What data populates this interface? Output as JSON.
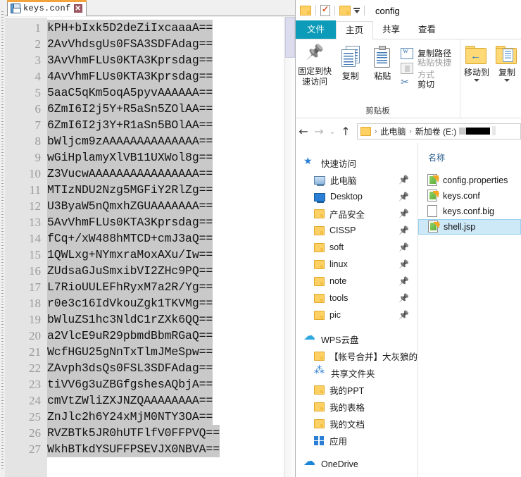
{
  "editor": {
    "tab": {
      "label": "keys.conf",
      "icon": "save-disk-icon",
      "close_label": "✕"
    },
    "lines": [
      {
        "no": "1",
        "text": "kPH+bIxk5D2deZiIxcaaaA=="
      },
      {
        "no": "2",
        "text": "2AvVhdsgUs0FSA3SDFAdag=="
      },
      {
        "no": "3",
        "text": "3AvVhmFLUs0KTA3Kprsdag=="
      },
      {
        "no": "4",
        "text": "4AvVhmFLUs0KTA3Kprsdag=="
      },
      {
        "no": "5",
        "text": "5aaC5qKm5oqA5pyvAAAAAA=="
      },
      {
        "no": "6",
        "text": "6ZmI6I2j5Y+R5aSn5ZOlAA=="
      },
      {
        "no": "7",
        "text": "6ZmI6I2j3Y+R1aSn5BOlAA=="
      },
      {
        "no": "8",
        "text": "bWljcm9zAAAAAAAAAAAAAA=="
      },
      {
        "no": "9",
        "text": "wGiHplamyXlVB11UXWol8g=="
      },
      {
        "no": "10",
        "text": "Z3VucwAAAAAAAAAAAAAAAA=="
      },
      {
        "no": "11",
        "text": "MTIzNDU2Nzg5MGFiY2RlZg=="
      },
      {
        "no": "12",
        "text": "U3ByaW5nQmxhZGUAAAAAAA=="
      },
      {
        "no": "13",
        "text": "5AvVhmFLUs0KTA3Kprsdag=="
      },
      {
        "no": "14",
        "text": "fCq+/xW488hMTCD+cmJ3aQ=="
      },
      {
        "no": "15",
        "text": "1QWLxg+NYmxraMoxAXu/Iw=="
      },
      {
        "no": "16",
        "text": "ZUdsaGJuSmxibVI2ZHc9PQ=="
      },
      {
        "no": "17",
        "text": "L7RioUULEFhRyxM7a2R/Yg=="
      },
      {
        "no": "18",
        "text": "r0e3c16IdVkouZgk1TKVMg=="
      },
      {
        "no": "19",
        "text": "bWluZS1hc3NldC1rZXk6QQ=="
      },
      {
        "no": "20",
        "text": "a2VlcE9uR29pbmdBbmRGaQ=="
      },
      {
        "no": "21",
        "text": "WcfHGU25gNnTxTlmJMeSpw=="
      },
      {
        "no": "22",
        "text": "ZAvph3dsQs0FSL3SDFAdag=="
      },
      {
        "no": "23",
        "text": "tiVV6g3uZBGfgshesAQbjA=="
      },
      {
        "no": "24",
        "text": "cmVtZWliZXJNZQAAAAAAAA=="
      },
      {
        "no": "25",
        "text": "ZnJlc2h6Y24xMjM0NTY3OA=="
      },
      {
        "no": "26",
        "text": "RVZBTk5JR0hUTFlfV0FFPVQ=="
      },
      {
        "no": "27",
        "text": "WkhBTkdYSUFFPSEVJX0NBVA=="
      }
    ]
  },
  "explorer": {
    "titlebar": {
      "title": "config",
      "quick_access_icons": [
        "folder-icon",
        "properties-icon",
        "new-folder-icon",
        "customize-caret-icon"
      ]
    },
    "tabs": [
      {
        "label": "文件",
        "state": "file-menu"
      },
      {
        "label": "主页",
        "state": "active"
      },
      {
        "label": "共享",
        "state": "normal"
      },
      {
        "label": "查看",
        "state": "normal"
      }
    ],
    "ribbon": {
      "group_clipboard_label": "剪贴板",
      "buttons": [
        {
          "label": "固定到快\n速访问",
          "line1": "固定到快",
          "line2": "速访问",
          "icon": "pin-icon"
        },
        {
          "label": "复制",
          "icon": "copy-icon"
        },
        {
          "label": "粘贴",
          "icon": "paste-icon"
        }
      ],
      "small_commands": [
        {
          "label": "复制路径",
          "icon": "copy-path-icon",
          "enabled": true
        },
        {
          "label": "粘贴快捷方式",
          "icon": "paste-shortcut-icon",
          "enabled": false
        },
        {
          "label": "剪切",
          "icon": "scissors-icon",
          "enabled": true
        }
      ],
      "organize": [
        {
          "label": "移动到",
          "icon": "move-to-icon"
        },
        {
          "label": "复制",
          "icon": "copy-to-icon"
        }
      ]
    },
    "nav": {
      "back_label": "←",
      "forward_label": "→",
      "recent_label": "⌄",
      "up_label": "↑",
      "breadcrumbs": [
        {
          "label": "此电脑",
          "type": "text"
        },
        {
          "label": "新加卷 (E:)",
          "type": "text"
        },
        {
          "label": "",
          "type": "redacted"
        }
      ]
    },
    "navigation_pane": [
      {
        "label": "快速访问",
        "icon": "star-pin-icon",
        "level": "root",
        "pinned": false
      },
      {
        "label": "此电脑",
        "icon": "this-pc-icon",
        "level": "child",
        "pinned": true
      },
      {
        "label": "Desktop",
        "icon": "desktop-icon",
        "level": "child",
        "pinned": true
      },
      {
        "label": "产品安全",
        "icon": "folder-icon",
        "level": "child",
        "pinned": true
      },
      {
        "label": "CISSP",
        "icon": "folder-icon",
        "level": "child",
        "pinned": true
      },
      {
        "label": "soft",
        "icon": "folder-icon",
        "level": "child",
        "pinned": true
      },
      {
        "label": "linux",
        "icon": "folder-icon",
        "level": "child",
        "pinned": true
      },
      {
        "label": "note",
        "icon": "folder-icon",
        "level": "child",
        "pinned": true
      },
      {
        "label": "tools",
        "icon": "folder-icon",
        "level": "child",
        "pinned": true
      },
      {
        "label": "pic",
        "icon": "folder-icon",
        "level": "child",
        "pinned": true
      },
      {
        "label": "WPS云盘",
        "icon": "cloud-icon",
        "level": "root",
        "pinned": false
      },
      {
        "label": "【帐号合并】大灰狼的文",
        "icon": "folder-icon",
        "level": "child",
        "pinned": false
      },
      {
        "label": "共享文件夹",
        "icon": "share-icon",
        "level": "child",
        "pinned": false
      },
      {
        "label": "我的PPT",
        "icon": "folder-icon",
        "level": "child",
        "pinned": false
      },
      {
        "label": "我的表格",
        "icon": "folder-icon",
        "level": "child",
        "pinned": false
      },
      {
        "label": "我的文档",
        "icon": "folder-icon",
        "level": "child",
        "pinned": false
      },
      {
        "label": "应用",
        "icon": "apps-icon",
        "level": "child",
        "pinned": false
      },
      {
        "label": "OneDrive",
        "icon": "onedrive-icon",
        "level": "root",
        "pinned": false
      }
    ],
    "file_list": {
      "column_header": "名称",
      "rows": [
        {
          "name": "config.properties",
          "icon": "notepadpp-file-icon",
          "selected": false
        },
        {
          "name": "keys.conf",
          "icon": "notepadpp-file-icon",
          "selected": false
        },
        {
          "name": "keys.conf.big",
          "icon": "blank-file-icon",
          "selected": false
        },
        {
          "name": "shell.jsp",
          "icon": "notepadpp-file-icon",
          "selected": true
        }
      ]
    }
  },
  "colors": {
    "file_tab_accent": "#0c9bb8",
    "selection_blue": "#cde8f7",
    "editor_selection_gray": "#c9c9c9",
    "tab_active_orange": "#f2a33c",
    "folder_yellow": "#ffd063"
  }
}
